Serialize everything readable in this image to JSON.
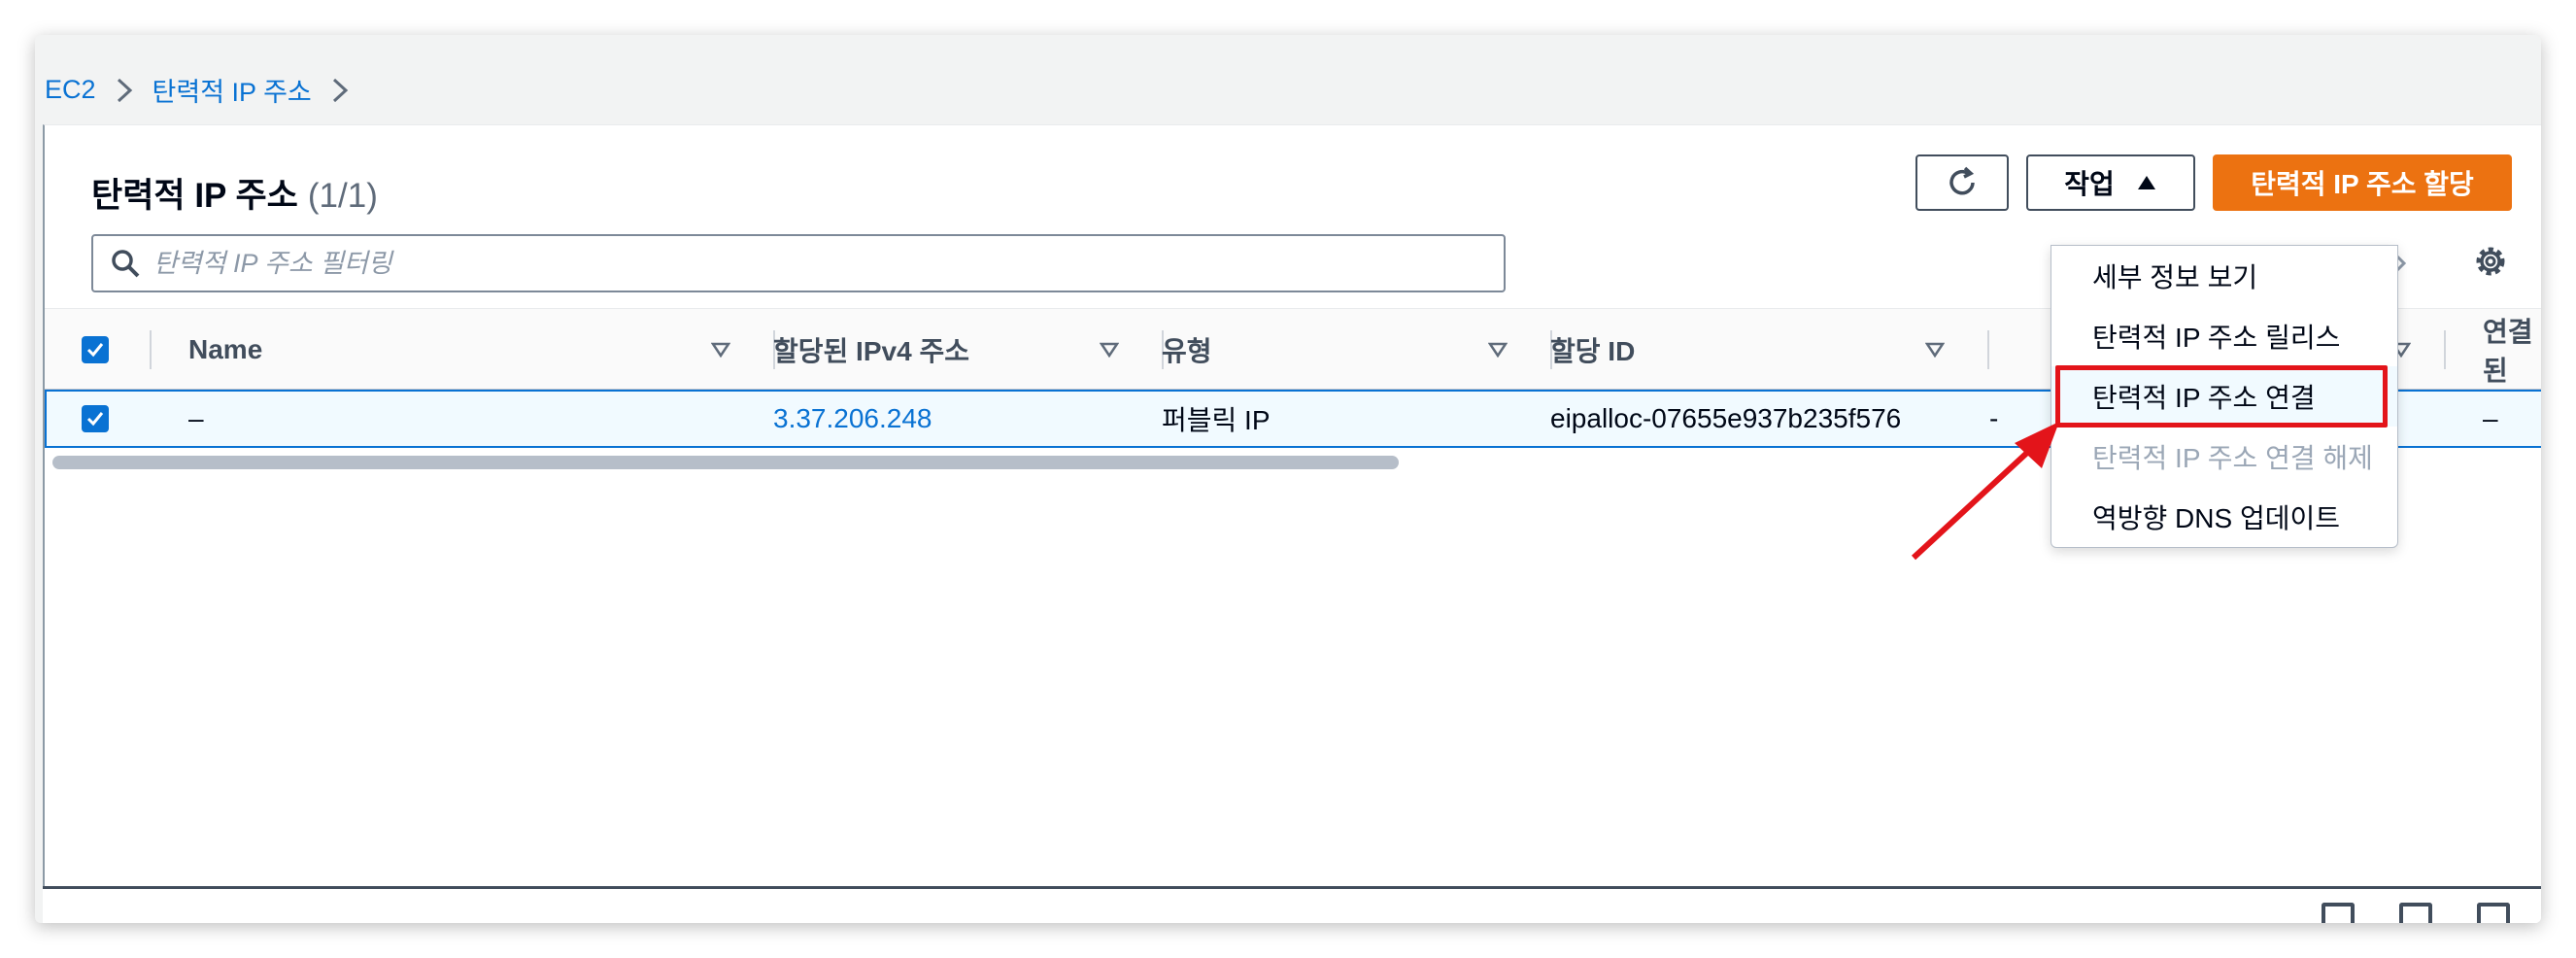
{
  "breadcrumb": {
    "items": [
      "EC2",
      "탄력적 IP 주소"
    ]
  },
  "header": {
    "title": "탄력적 IP 주소",
    "count": "(1/1)"
  },
  "toolbar": {
    "actions_label": "작업",
    "allocate_label": "탄력적 IP 주소 할당"
  },
  "search": {
    "placeholder": "탄력적 IP 주소 필터링"
  },
  "table": {
    "columns": [
      "Name",
      "할당된 IPv4 주소",
      "유형",
      "할당 ID",
      "연결된"
    ],
    "rows": [
      {
        "name": "–",
        "ipv4": "3.37.206.248",
        "type": "퍼블릭 IP",
        "allocation_id": "eipalloc-07655e937b235f576",
        "associated": "–",
        "partial": "-"
      }
    ]
  },
  "dropdown": {
    "items": [
      {
        "label": "세부 정보 보기",
        "disabled": false
      },
      {
        "label": "탄력적 IP 주소 릴리스",
        "disabled": false
      },
      {
        "label": "탄력적 IP 주소 연결",
        "disabled": false
      },
      {
        "label": "탄력적 IP 주소 연결 해제",
        "disabled": true
      },
      {
        "label": "역방향 DNS 업데이트",
        "disabled": false
      }
    ]
  },
  "colors": {
    "primary": "#ec7211",
    "link": "#0972d3",
    "annotation": "#e3141a"
  },
  "icons": [
    "chevron-right-icon",
    "refresh-icon",
    "caret-up-icon",
    "search-icon",
    "settings-icon",
    "checkbox-checked-icon",
    "sort-icon"
  ]
}
